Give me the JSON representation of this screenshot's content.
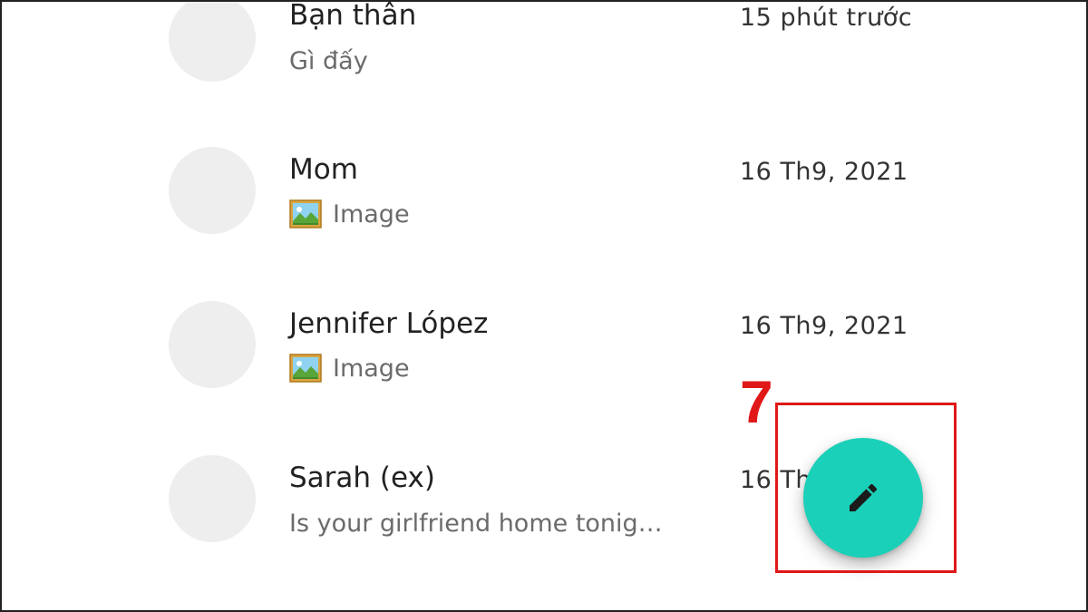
{
  "conversations": [
    {
      "name": "Bạn thân",
      "snippet": "Gì đấy",
      "time": "15 phút trước",
      "attachment": null
    },
    {
      "name": "Mom",
      "snippet": "Image",
      "time": "16 Th9, 2021",
      "attachment": "image-icon"
    },
    {
      "name": "Jennifer López",
      "snippet": "Image",
      "time": "16 Th9, 2021",
      "attachment": "image-icon"
    },
    {
      "name": "Sarah (ex)",
      "snippet": "Is your girlfriend home tonig…",
      "time": "16 Th",
      "attachment": null
    }
  ],
  "fab": {
    "icon": "pencil-icon",
    "color": "#1ad0b8"
  },
  "annotation": {
    "step": "7",
    "color": "#e01818"
  }
}
